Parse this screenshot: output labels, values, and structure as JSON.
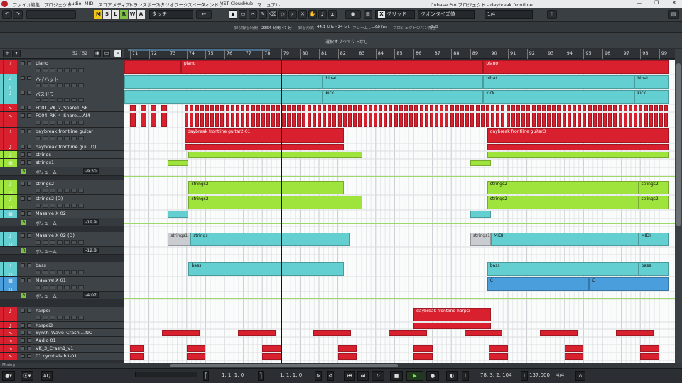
{
  "menubar": {
    "items": [
      "ファイル",
      "編集",
      "プロジェクト",
      "Audio",
      "MIDI",
      "スコア",
      "メディア",
      "トランスポート",
      "スタジオ",
      "ワークスペース",
      "ウィンドウ",
      "VST Cloud",
      "Hub",
      "マニュアル"
    ],
    "window_title": "Cubase Pro プロジェクト - daybreak frontline",
    "minimize": "—",
    "maximize": "❐",
    "close": "✕"
  },
  "toolbar": {
    "modes": [
      "M",
      "S",
      "L",
      "R",
      "W",
      "A"
    ],
    "mode_colors": [
      "#f0c419",
      "#e6e6e6",
      "#e6e6e6",
      "#7fc241",
      "#e6e6e6",
      "#e6e6e6"
    ],
    "automation_mode": "タッチ",
    "snap_type": "グリッド",
    "quantize_type": "クオンタイズ値",
    "quantize_value": "1/4",
    "grid_icon": "X"
  },
  "infoline": {
    "rec_time_label": "録り録音時間",
    "rec_time": "2354 時間 47 分",
    "rec_format_label": "録音形式",
    "rec_format": "44.1 kHz - 24 bit",
    "frame_label": "フレームレート",
    "frame": "60 fps",
    "pan_label": "プロジェクトのパン補正",
    "pan": "-3dB"
  },
  "selection": {
    "text": "選択オブジェクトなし"
  },
  "listhead": {
    "count": "52 / 52"
  },
  "ruler": {
    "bars": [
      "71",
      "72",
      "73",
      "74",
      "75",
      "76",
      "77",
      "78",
      "79",
      "80",
      "81",
      "82",
      "83",
      "84",
      "85",
      "86",
      "87",
      "88",
      "89",
      "90",
      "91",
      "92",
      "93",
      "94",
      "95",
      "96",
      "97",
      "98",
      "99"
    ]
  },
  "tracks": [
    {
      "num": "",
      "name": "piano",
      "color": "#d8202e",
      "kind": "midi"
    },
    {
      "num": "6",
      "name": "ハイハット",
      "color": "#63cfd1",
      "kind": "midi"
    },
    {
      "num": "",
      "name": "バスドラ",
      "color": "#63cfd1",
      "kind": "midi"
    },
    {
      "num": "",
      "name": "FC01_VK_2_Snare1_SR",
      "color": "#d8202e",
      "kind": "audio"
    },
    {
      "num": "",
      "name": "FC04_RK_4_Snare....AM",
      "color": "#d8202e",
      "kind": "audio"
    },
    {
      "num": "",
      "name": "daybreak frontline guitar",
      "color": "#d8202e",
      "kind": "midi"
    },
    {
      "num": "",
      "name": "daybreak frontline gui...D)",
      "color": "#d8202e",
      "kind": "midi"
    },
    {
      "num": "14",
      "name": "strings",
      "color": "#9ee43c",
      "kind": "midi"
    },
    {
      "num": "15",
      "name": "strings1",
      "color": "#9ee43c",
      "kind": "inst"
    },
    {
      "num": "16",
      "name": "strings2",
      "color": "#9ee43c",
      "kind": "midi"
    },
    {
      "num": "17",
      "name": "strings2 (D)",
      "color": "#9ee43c",
      "kind": "midi"
    },
    {
      "num": "18",
      "name": "Massive X 02",
      "color": "#63cfd1",
      "kind": "inst"
    },
    {
      "num": "19",
      "name": "Massive X 02 (D)",
      "color": "#63cfd1",
      "kind": "midi"
    },
    {
      "num": "20",
      "name": "bass",
      "color": "#63cfd1",
      "kind": "midi"
    },
    {
      "num": "21",
      "name": "Massive X 01",
      "color": "#4a9edc",
      "kind": "inst"
    },
    {
      "num": "",
      "name": "harpsi",
      "color": "#d8202e",
      "kind": "midi"
    },
    {
      "num": "",
      "name": "harpsi2",
      "color": "#d8202e",
      "kind": "midi"
    },
    {
      "num": "",
      "name": "Synth_Wave_Crash....NC",
      "color": "#d8202e",
      "kind": "audio"
    },
    {
      "num": "",
      "name": "Audio 01",
      "color": "#d8202e",
      "kind": "audio"
    },
    {
      "num": "",
      "name": "VK_3_Crash1_v1",
      "color": "#d8202e",
      "kind": "audio"
    },
    {
      "num": "",
      "name": "01 cymbals hit-01",
      "color": "#d8202e",
      "kind": "audio"
    }
  ],
  "auto_lanes": [
    {
      "name": "ボリューム",
      "value": "-9.30"
    },
    {
      "name": "ボリューム",
      "value": "-19.9"
    },
    {
      "name": "ボリューム",
      "value": "-12.8"
    },
    {
      "name": "ボリューム",
      "value": "-4.07"
    }
  ],
  "events": [
    {
      "label": "piano",
      "color": "red"
    },
    {
      "label": "piano",
      "color": "red"
    },
    {
      "label": "hihat",
      "color": "cyan"
    },
    {
      "label": "hihat",
      "color": "cyan"
    },
    {
      "label": "hihat",
      "color": "cyan"
    },
    {
      "label": "kick",
      "color": "cyan"
    },
    {
      "label": "kick",
      "color": "cyan"
    },
    {
      "label": "kick",
      "color": "cyan"
    },
    {
      "label": "daybreak frontline guitar2-01",
      "color": "red"
    },
    {
      "label": "daybreak frontline guitar3",
      "color": "red"
    },
    {
      "label": "strings2",
      "color": "green"
    },
    {
      "label": "strings2",
      "color": "green"
    },
    {
      "label": "strings2",
      "color": "green"
    },
    {
      "label": "strings2",
      "color": "green"
    },
    {
      "label": "strings2",
      "color": "green"
    },
    {
      "label": "strings2",
      "color": "green"
    },
    {
      "label": "strings1",
      "color": "grey"
    },
    {
      "label": "strings",
      "color": "cyan"
    },
    {
      "label": "strings1",
      "color": "grey"
    },
    {
      "label": "MIDI",
      "color": "cyan"
    },
    {
      "label": "MIDI",
      "color": "cyan"
    },
    {
      "label": "bass",
      "color": "cyan"
    },
    {
      "label": "bass",
      "color": "cyan"
    },
    {
      "label": "bass",
      "color": "cyan"
    },
    {
      "label": "C",
      "color": "blue"
    },
    {
      "label": "C",
      "color": "blue"
    },
    {
      "label": "daybreak frontline harpsi",
      "color": "red"
    }
  ],
  "hscroll": {
    "label": "Mixing"
  },
  "transport": {
    "aq": "AQ",
    "left_locator": "1. 1. 1.  0",
    "right_locator": "1. 1. 1.  0",
    "position": "78. 3. 2. 104",
    "tempo": "137.000",
    "signature": "4/4"
  }
}
